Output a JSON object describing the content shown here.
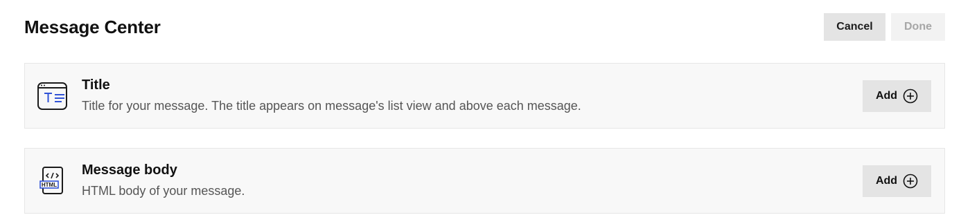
{
  "header": {
    "title": "Message Center",
    "cancel_label": "Cancel",
    "done_label": "Done"
  },
  "cards": [
    {
      "icon": "title-text-icon",
      "title": "Title",
      "description": "Title for your message. The title appears on message's list view and above each message.",
      "add_label": "Add",
      "add_icon": "plus-circle-icon"
    },
    {
      "icon": "html-file-icon",
      "icon_badge_text": "HTML",
      "title": "Message body",
      "description": "HTML body of your message.",
      "add_label": "Add",
      "add_icon": "plus-circle-icon"
    }
  ],
  "colors": {
    "accent_blue": "#2f52d6",
    "card_bg": "#f8f8f8",
    "button_bg": "#e4e4e4",
    "disabled_text": "#a6a6a6"
  }
}
